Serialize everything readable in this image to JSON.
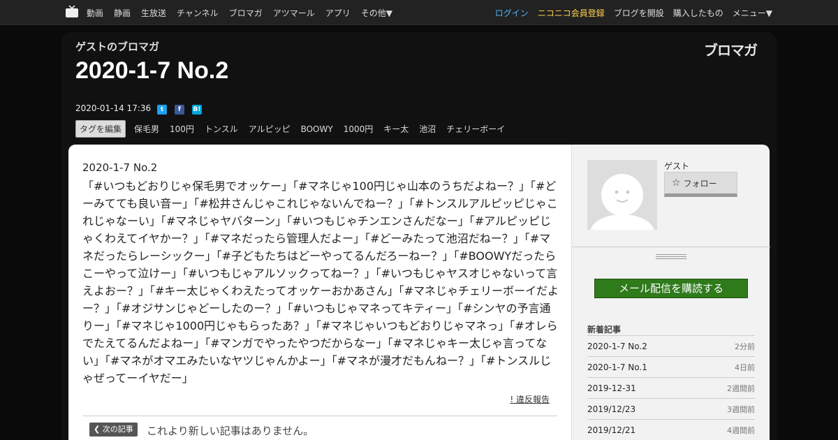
{
  "nav": {
    "left": [
      "動画",
      "静画",
      "生放送",
      "チャンネル",
      "ブロマガ",
      "アツマール",
      "アプリ",
      "その他▼"
    ],
    "login": "ログイン",
    "register": "ニコニコ会員登録",
    "right": [
      "ブログを開設",
      "購入したもの",
      "メニュー▼"
    ]
  },
  "header": {
    "blog_name": "ゲストのブロマガ",
    "brand": "ブロマガ",
    "title": "2020-1-7 No.2",
    "date": "2020-01-14 17:36",
    "tag_edit": "タグを編集",
    "tags": [
      "保毛男",
      "100円",
      "トンスル",
      "アルピッピ",
      "BOOWY",
      "1000円",
      "キー太",
      "池沼",
      "チェリーボーイ"
    ]
  },
  "article": {
    "title": "2020-1-7 No.2",
    "body": "「#いつもどおりじゃ保毛男でオッケー」「#マネじゃ100円じゃ山本のうちだよねー？」「#どーみてても良い音ー」「#松井さんじゃこれじゃないんでねー？」「#トンスルアルピッピじゃこれじゃなーい」「#マネじゃヤバターン」「#いつもじゃチンエンさんだなー」「#アルピッピじゃくわえてイヤかー？」「#マネだったら管理人だよー」「#どーみたって池沼だねー？」「#マネだったらレーシックー」「#子どもたちはどーやってるんだろーねー？」「#BOOWYだったらこーやって泣けー」「#いつもじゃアルソックってねー？」「#いつもじゃヤスオじゃないって言えよおー？」「#キー太じゃくわえたってオッケーおかあさん」「#マネじゃチェリーボーイだよー？」「#オジサンじゃどーしたのー？」「#いつもじゃマネってキティー」「#シンヤの予言通りー」「#マネじゃ1000円じゃもらったあ？」「#マネじゃいつもどおりじゃマネっ」「#オレらでたえてるんだよねー」「#マンガでやったやつだからなー」「#マネじゃキー太じゃ言ってない」「#マネがオマエみたいなヤツじゃんかよー」「#マネが漫才だもんねー？」「#トンスルじゃぜってーイヤだー」",
    "report": "! 違反報告",
    "next_label": "次の記事",
    "no_newer": "これより新しい記事はありません。"
  },
  "sidebar": {
    "guest": "ゲスト",
    "follow": "フォロー",
    "mail_button": "メール配信を購読する",
    "recent_heading": "新着記事",
    "recent": [
      {
        "title": "2020-1-7 No.2",
        "ago": "2分前"
      },
      {
        "title": "2020-1-7 No.1",
        "ago": "4日前"
      },
      {
        "title": "2019-12-31",
        "ago": "2週間前"
      },
      {
        "title": "2019/12/23",
        "ago": "3週間前"
      },
      {
        "title": "2019/12/21",
        "ago": "4週間前"
      }
    ]
  },
  "colors": {
    "accent_login": "#4fb5ff",
    "accent_register": "#ffd24d",
    "mail_button": "#2f7a1b"
  }
}
